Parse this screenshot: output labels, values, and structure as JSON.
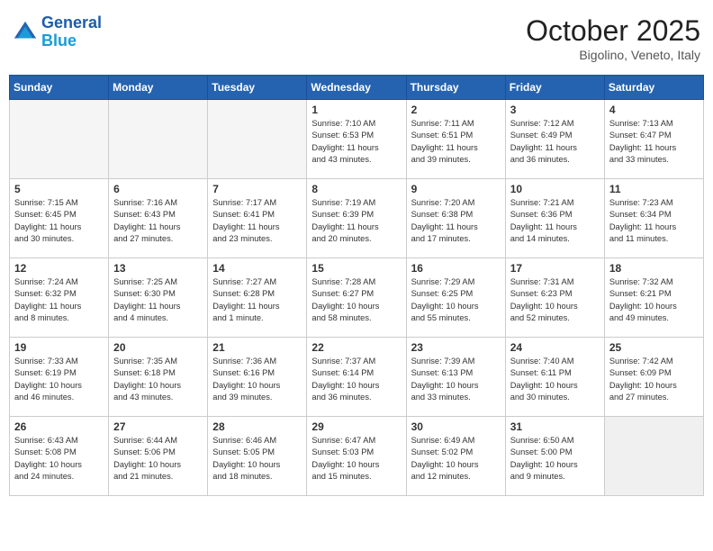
{
  "header": {
    "logo_line1": "General",
    "logo_line2": "Blue",
    "month": "October 2025",
    "location": "Bigolino, Veneto, Italy"
  },
  "weekdays": [
    "Sunday",
    "Monday",
    "Tuesday",
    "Wednesday",
    "Thursday",
    "Friday",
    "Saturday"
  ],
  "weeks": [
    [
      {
        "day": "",
        "info": "",
        "empty": true
      },
      {
        "day": "",
        "info": "",
        "empty": true
      },
      {
        "day": "",
        "info": "",
        "empty": true
      },
      {
        "day": "1",
        "info": "Sunrise: 7:10 AM\nSunset: 6:53 PM\nDaylight: 11 hours\nand 43 minutes.",
        "empty": false
      },
      {
        "day": "2",
        "info": "Sunrise: 7:11 AM\nSunset: 6:51 PM\nDaylight: 11 hours\nand 39 minutes.",
        "empty": false
      },
      {
        "day": "3",
        "info": "Sunrise: 7:12 AM\nSunset: 6:49 PM\nDaylight: 11 hours\nand 36 minutes.",
        "empty": false
      },
      {
        "day": "4",
        "info": "Sunrise: 7:13 AM\nSunset: 6:47 PM\nDaylight: 11 hours\nand 33 minutes.",
        "empty": false
      }
    ],
    [
      {
        "day": "5",
        "info": "Sunrise: 7:15 AM\nSunset: 6:45 PM\nDaylight: 11 hours\nand 30 minutes.",
        "empty": false
      },
      {
        "day": "6",
        "info": "Sunrise: 7:16 AM\nSunset: 6:43 PM\nDaylight: 11 hours\nand 27 minutes.",
        "empty": false
      },
      {
        "day": "7",
        "info": "Sunrise: 7:17 AM\nSunset: 6:41 PM\nDaylight: 11 hours\nand 23 minutes.",
        "empty": false
      },
      {
        "day": "8",
        "info": "Sunrise: 7:19 AM\nSunset: 6:39 PM\nDaylight: 11 hours\nand 20 minutes.",
        "empty": false
      },
      {
        "day": "9",
        "info": "Sunrise: 7:20 AM\nSunset: 6:38 PM\nDaylight: 11 hours\nand 17 minutes.",
        "empty": false
      },
      {
        "day": "10",
        "info": "Sunrise: 7:21 AM\nSunset: 6:36 PM\nDaylight: 11 hours\nand 14 minutes.",
        "empty": false
      },
      {
        "day": "11",
        "info": "Sunrise: 7:23 AM\nSunset: 6:34 PM\nDaylight: 11 hours\nand 11 minutes.",
        "empty": false
      }
    ],
    [
      {
        "day": "12",
        "info": "Sunrise: 7:24 AM\nSunset: 6:32 PM\nDaylight: 11 hours\nand 8 minutes.",
        "empty": false
      },
      {
        "day": "13",
        "info": "Sunrise: 7:25 AM\nSunset: 6:30 PM\nDaylight: 11 hours\nand 4 minutes.",
        "empty": false
      },
      {
        "day": "14",
        "info": "Sunrise: 7:27 AM\nSunset: 6:28 PM\nDaylight: 11 hours\nand 1 minute.",
        "empty": false
      },
      {
        "day": "15",
        "info": "Sunrise: 7:28 AM\nSunset: 6:27 PM\nDaylight: 10 hours\nand 58 minutes.",
        "empty": false
      },
      {
        "day": "16",
        "info": "Sunrise: 7:29 AM\nSunset: 6:25 PM\nDaylight: 10 hours\nand 55 minutes.",
        "empty": false
      },
      {
        "day": "17",
        "info": "Sunrise: 7:31 AM\nSunset: 6:23 PM\nDaylight: 10 hours\nand 52 minutes.",
        "empty": false
      },
      {
        "day": "18",
        "info": "Sunrise: 7:32 AM\nSunset: 6:21 PM\nDaylight: 10 hours\nand 49 minutes.",
        "empty": false
      }
    ],
    [
      {
        "day": "19",
        "info": "Sunrise: 7:33 AM\nSunset: 6:19 PM\nDaylight: 10 hours\nand 46 minutes.",
        "empty": false
      },
      {
        "day": "20",
        "info": "Sunrise: 7:35 AM\nSunset: 6:18 PM\nDaylight: 10 hours\nand 43 minutes.",
        "empty": false
      },
      {
        "day": "21",
        "info": "Sunrise: 7:36 AM\nSunset: 6:16 PM\nDaylight: 10 hours\nand 39 minutes.",
        "empty": false
      },
      {
        "day": "22",
        "info": "Sunrise: 7:37 AM\nSunset: 6:14 PM\nDaylight: 10 hours\nand 36 minutes.",
        "empty": false
      },
      {
        "day": "23",
        "info": "Sunrise: 7:39 AM\nSunset: 6:13 PM\nDaylight: 10 hours\nand 33 minutes.",
        "empty": false
      },
      {
        "day": "24",
        "info": "Sunrise: 7:40 AM\nSunset: 6:11 PM\nDaylight: 10 hours\nand 30 minutes.",
        "empty": false
      },
      {
        "day": "25",
        "info": "Sunrise: 7:42 AM\nSunset: 6:09 PM\nDaylight: 10 hours\nand 27 minutes.",
        "empty": false
      }
    ],
    [
      {
        "day": "26",
        "info": "Sunrise: 6:43 AM\nSunset: 5:08 PM\nDaylight: 10 hours\nand 24 minutes.",
        "empty": false
      },
      {
        "day": "27",
        "info": "Sunrise: 6:44 AM\nSunset: 5:06 PM\nDaylight: 10 hours\nand 21 minutes.",
        "empty": false
      },
      {
        "day": "28",
        "info": "Sunrise: 6:46 AM\nSunset: 5:05 PM\nDaylight: 10 hours\nand 18 minutes.",
        "empty": false
      },
      {
        "day": "29",
        "info": "Sunrise: 6:47 AM\nSunset: 5:03 PM\nDaylight: 10 hours\nand 15 minutes.",
        "empty": false
      },
      {
        "day": "30",
        "info": "Sunrise: 6:49 AM\nSunset: 5:02 PM\nDaylight: 10 hours\nand 12 minutes.",
        "empty": false
      },
      {
        "day": "31",
        "info": "Sunrise: 6:50 AM\nSunset: 5:00 PM\nDaylight: 10 hours\nand 9 minutes.",
        "empty": false
      },
      {
        "day": "",
        "info": "",
        "empty": true
      }
    ]
  ]
}
